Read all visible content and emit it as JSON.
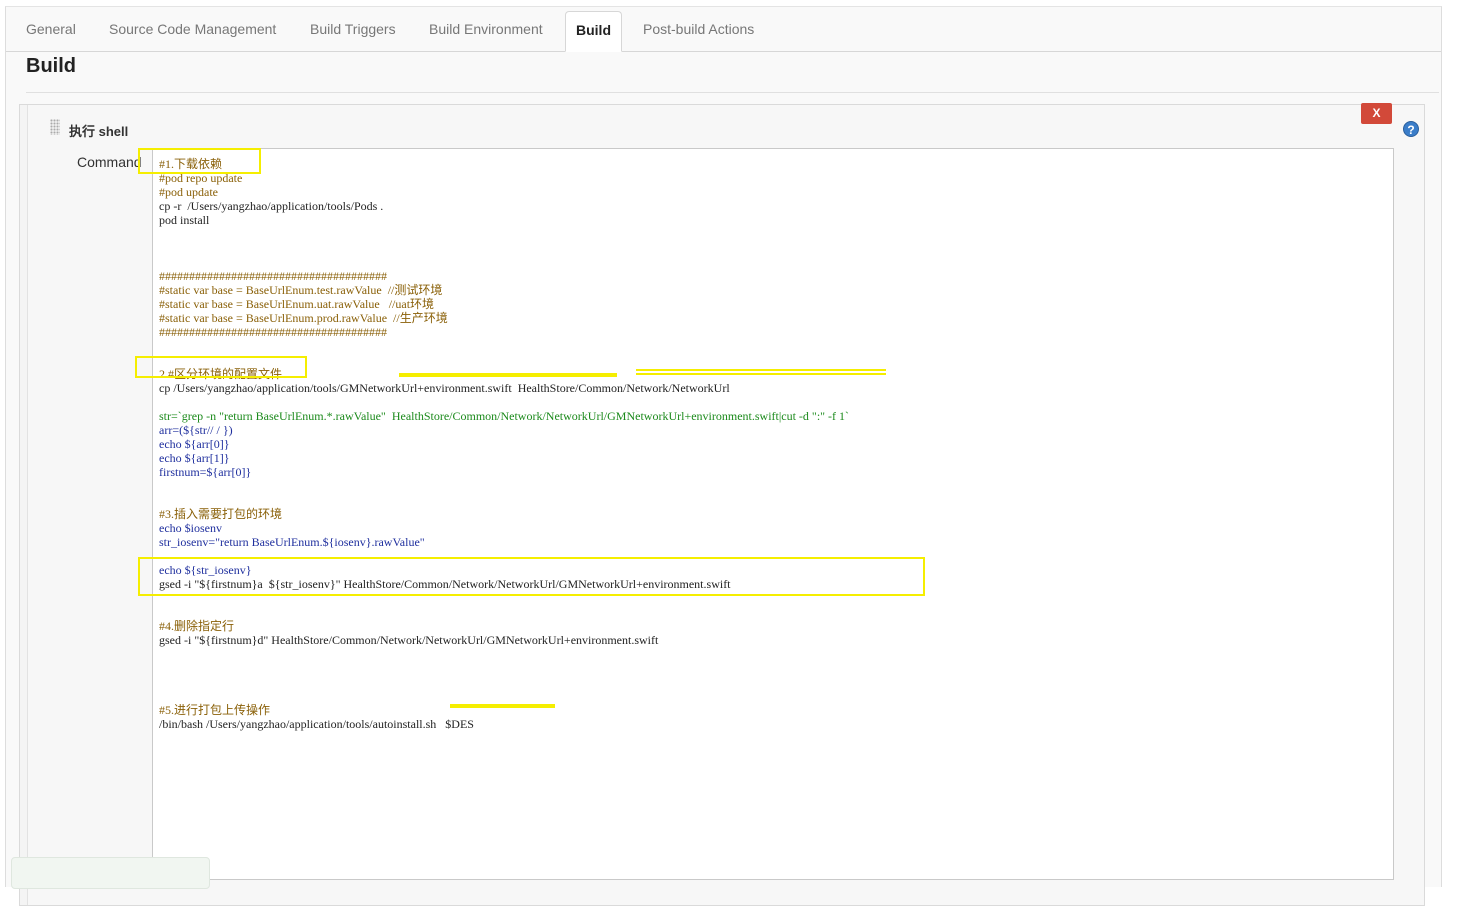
{
  "tabs": [
    {
      "label": "General"
    },
    {
      "label": "Source Code Management"
    },
    {
      "label": "Build Triggers"
    },
    {
      "label": "Build Environment"
    },
    {
      "label": "Build"
    },
    {
      "label": "Post-build Actions"
    }
  ],
  "active_tab": "Build",
  "section": {
    "title": "Build"
  },
  "build_step": {
    "title": "执行 shell",
    "delete_label": "X",
    "help_icon": "question-circle-icon",
    "grip_icon": "drag-handle-icon",
    "command_label": "Command"
  },
  "colors": {
    "highlight": "#f5ee00",
    "delete_button": "#d24939",
    "comment": "#8a6008",
    "command": "#1f2f9e",
    "string": "#1b8a1b"
  },
  "command_lines": [
    "#1.下载依赖",
    "#pod repo update",
    "#pod update",
    "cp -r  /Users/yangzhao/application/tools/Pods .",
    "pod install",
    "",
    "",
    "",
    "######################################",
    "#static var base = BaseUrlEnum.test.rawValue  //测试环境",
    "#static var base = BaseUrlEnum.uat.rawValue   //uat环境",
    "#static var base = BaseUrlEnum.prod.rawValue  //生产环境",
    "######################################",
    "",
    "",
    "2.#区分环境的配置文件",
    "cp /Users/yangzhao/application/tools/GMNetworkUrl+environment.swift  HealthStore/Common/Network/NetworkUrl",
    "",
    "str=`grep -n \"return BaseUrlEnum.*.rawValue\"  HealthStore/Common/Network/NetworkUrl/GMNetworkUrl+environment.swift|cut -d \":\" -f 1`",
    "arr=(${str// / })",
    "echo ${arr[0]}",
    "echo ${arr[1]}",
    "firstnum=${arr[0]}",
    "",
    "",
    "#3.插入需要打包的环境",
    "echo $iosenv",
    "str_iosenv=\"return BaseUrlEnum.${iosenv}.rawValue\"",
    "",
    "echo ${str_iosenv}",
    "gsed -i \"${firstnum}a  ${str_iosenv}\" HealthStore/Common/Network/NetworkUrl/GMNetworkUrl+environment.swift",
    "",
    "",
    "#4.删除指定行",
    "gsed -i \"${firstnum}d\" HealthStore/Common/Network/NetworkUrl/GMNetworkUrl+environment.swift",
    "",
    "",
    "",
    "",
    "#5.进行打包上传操作",
    "/bin/bash /Users/yangzhao/application/tools/autoinstall.sh   $DES"
  ]
}
